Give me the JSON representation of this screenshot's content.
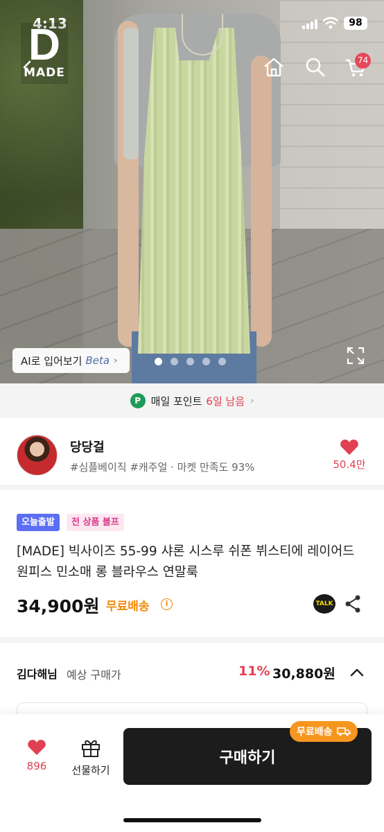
{
  "status_bar": {
    "time": "4:13",
    "battery": "98"
  },
  "header": {
    "logo_letter": "D",
    "logo_word": "MADE",
    "cart_count": "74",
    "icons": [
      "home-icon",
      "search-icon",
      "cart-icon"
    ]
  },
  "gallery": {
    "ai_try_on": "AI로 입어보기",
    "ai_beta": "Beta",
    "image_count": 5,
    "current_index": 1
  },
  "points_banner": {
    "icon_text": "P",
    "text": "매일 포인트",
    "highlight": "6일 남음"
  },
  "shop": {
    "name": "당당걸",
    "tags": "#심플베이직 #캐주얼 · 마켓 만족도 93%",
    "likes": "50.4만"
  },
  "product": {
    "badges": [
      "오늘출발",
      "전 상품 블프"
    ],
    "title": "[MADE] 빅사이즈 55-99 샤론 시스루 쉬폰 뷔스티에 레이어드 원피스 민소매 롱 블라우스 연말룩",
    "price": "34,900원",
    "shipping": "무료배송",
    "info_glyph": "i",
    "talk_label": "TALK"
  },
  "expected_price": {
    "user": "김다해님",
    "label": "예상 구매가",
    "discount": "11%",
    "amount": "30,880원"
  },
  "bottom_bar": {
    "like_count": "896",
    "gift_label": "선물하기",
    "buy_label": "구매하기",
    "free_shipping_tag": "무료배송"
  },
  "colors": {
    "accent_red": "#e04051",
    "shipping_orange": "#f08a0a",
    "badge_blue": "#5b6ef5",
    "badge_pink": "#d8398a",
    "buy_button": "#1c1c1c",
    "points_green": "#1f9b5a"
  }
}
